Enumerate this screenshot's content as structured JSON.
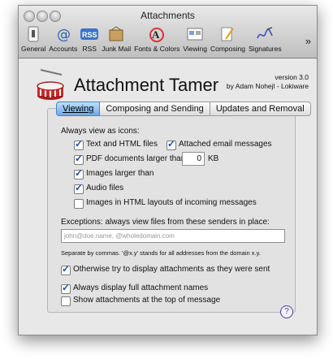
{
  "window": {
    "title": "Attachments"
  },
  "toolbar": {
    "items": [
      {
        "label": "General",
        "icon": "switch-icon"
      },
      {
        "label": "Accounts",
        "icon": "at-icon"
      },
      {
        "label": "RSS",
        "icon": "rss-icon"
      },
      {
        "label": "Junk Mail",
        "icon": "junk-mail-icon"
      },
      {
        "label": "Fonts & Colors",
        "icon": "fonts-colors-icon"
      },
      {
        "label": "Viewing",
        "icon": "viewing-icon"
      },
      {
        "label": "Composing",
        "icon": "composing-icon"
      },
      {
        "label": "Signatures",
        "icon": "signatures-icon"
      }
    ],
    "overflow": "»"
  },
  "header": {
    "app_title": "Attachment Tamer",
    "version": "version 3.0",
    "author": "by Adam Nohejl - Lokiware"
  },
  "tabs": [
    "Viewing",
    "Composing and Sending",
    "Updates and Removal"
  ],
  "viewing": {
    "section_label": "Always view as icons:",
    "text_html": "Text and HTML files",
    "attached_email": "Attached email messages",
    "pdf_larger": "PDF documents larger than",
    "pdf_value": "0",
    "pdf_unit": "KB",
    "images_larger": "Images larger than",
    "audio_files": "Audio files",
    "images_html": "Images in HTML layouts of incoming messages",
    "exceptions_label": "Exceptions: always view files from these senders in place:",
    "exceptions_placeholder": "john@doe.name, @wholedomain.com",
    "exceptions_hint": "Separate by commas. '@x.y' stands for all addresses from the domain x.y.",
    "otherwise_display": "Otherwise try to display attachments as they were sent",
    "full_names": "Always display full attachment names",
    "show_top": "Show attachments at the top of message",
    "help": "?"
  }
}
